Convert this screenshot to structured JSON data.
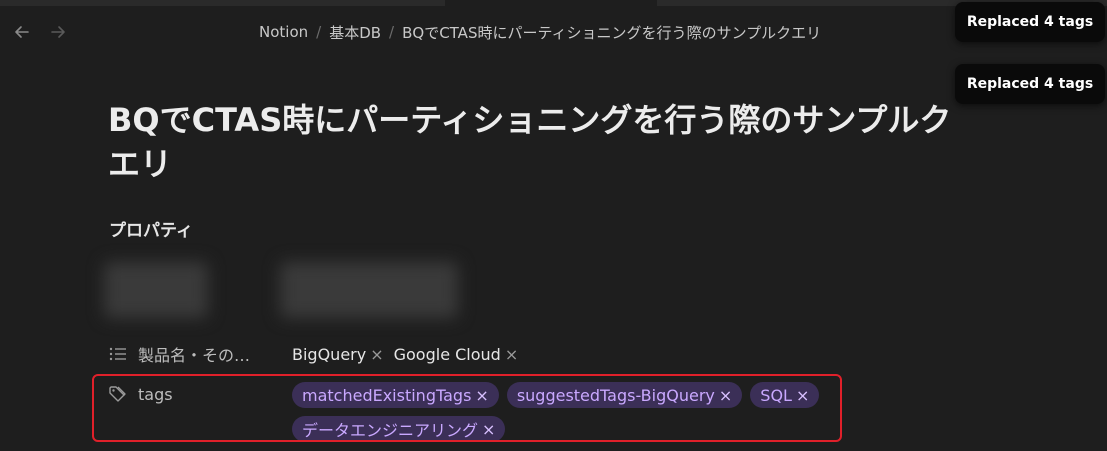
{
  "breadcrumb": {
    "items": [
      "Notion",
      "基本DB",
      "BQでCTAS時にパーティショニングを行う際のサンプルクエリ"
    ],
    "separator": "/"
  },
  "toasts": [
    "Replaced 4 tags",
    "Replaced 4 tags"
  ],
  "page": {
    "title": "BQでCTAS時にパーティショニングを行う際のサンプルクエリ",
    "properties_heading": "プロパティ"
  },
  "properties": {
    "product": {
      "label": "製品名・その…",
      "icon": "list-icon",
      "values": [
        "BigQuery",
        "Google Cloud"
      ]
    },
    "tags": {
      "label": "tags",
      "icon": "tag-icon",
      "values": [
        "matchedExistingTags",
        "suggestedTags-BigQuery",
        "SQL",
        "データエンジニアリング"
      ]
    }
  },
  "colors": {
    "background": "#1e1e1e",
    "pill_bg": "#3b2f57",
    "pill_text": "#c9a8ff",
    "highlight": "#e0202a",
    "toast_bg": "#0a0a0a"
  },
  "remove_glyph": "×"
}
